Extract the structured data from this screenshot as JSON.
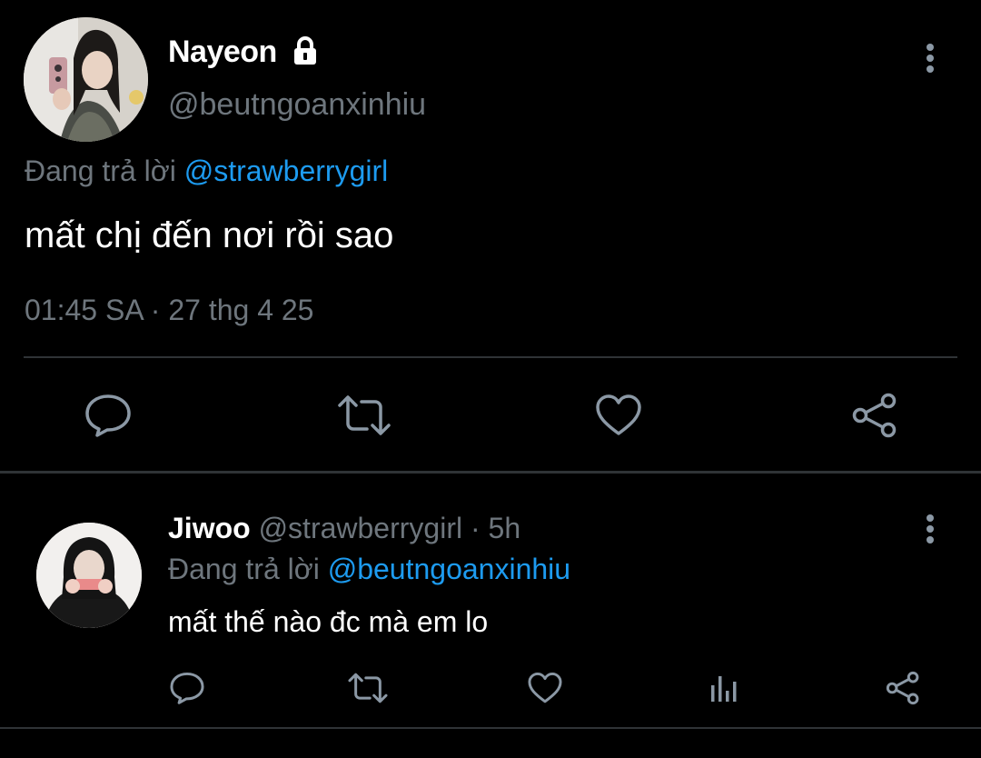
{
  "main_tweet": {
    "display_name": "Nayeon",
    "handle": "@beutngoanxinhiu",
    "reply_prefix": "Đang trả lời ",
    "reply_to": "@strawberrygirl",
    "text": "mất chị đến nơi rồi sao",
    "timestamp": "01:45 SA · 27 thg 4 25",
    "actions": [
      "reply-icon",
      "retweet-icon",
      "like-icon",
      "share-icon"
    ]
  },
  "reply_tweet": {
    "display_name": "Jiwoo",
    "handle": "@strawberrygirl",
    "separator": " · ",
    "time": "5h",
    "reply_prefix": "Đang trả lời ",
    "reply_to": "@beutngoanxinhiu",
    "text": "mất thế nào đc mà em lo",
    "actions": [
      "reply-icon",
      "retweet-icon",
      "like-icon",
      "analytics-icon",
      "share-icon"
    ]
  },
  "colors": {
    "background": "#000000",
    "text_primary": "#ffffff",
    "text_secondary": "#6e767d",
    "accent": "#1d9bf0",
    "divider": "#2f3336"
  }
}
